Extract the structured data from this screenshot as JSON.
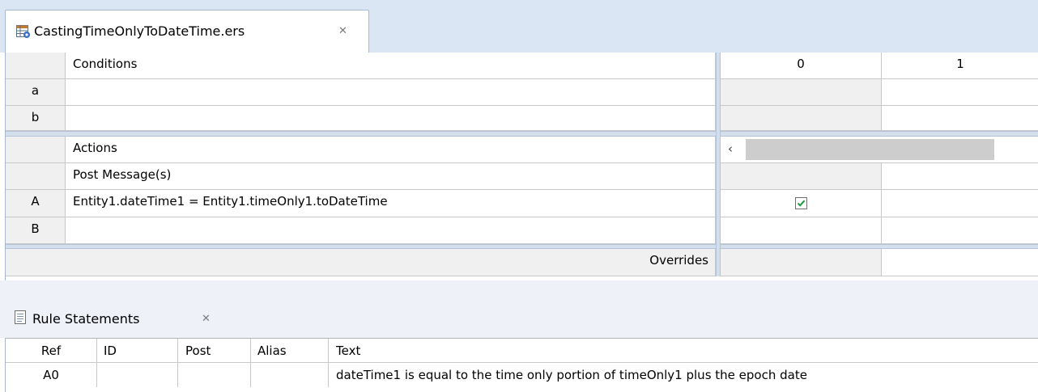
{
  "editor": {
    "tab_title": "CastingTimeOnlyToDateTime.ers",
    "tab_icon": "decision-table-icon",
    "close_icon": "close-icon",
    "conditions_header": "Conditions",
    "column_headers": [
      "0",
      "1"
    ],
    "condition_rows": [
      {
        "label": "a",
        "text": ""
      },
      {
        "label": "b",
        "text": ""
      }
    ],
    "actions_header": "Actions",
    "post_messages_label": "Post Message(s)",
    "action_rows": [
      {
        "label": "A",
        "text": "Entity1.dateTime1 = Entity1.timeOnly1.toDateTime",
        "col0_checked": true
      },
      {
        "label": "B",
        "text": "",
        "col0_checked": false
      }
    ],
    "overrides_label": "Overrides",
    "scroll_left_arrow": "‹"
  },
  "rule_statements": {
    "tab_title": "Rule Statements",
    "tab_icon": "document-icon",
    "close_icon": "close-icon",
    "columns": [
      "Ref",
      "ID",
      "Post",
      "Alias",
      "Text"
    ],
    "rows": [
      {
        "ref": "A0",
        "id": "",
        "post": "",
        "alias": "",
        "text": "dateTime1 is equal to the time only portion of timeOnly1 plus the epoch date"
      }
    ]
  },
  "colors": {
    "tab_bar": "#dbe6f4",
    "separator": "#d4dfee",
    "grey_cell": "#f0f0f0",
    "check_green": "#1e9a3c"
  }
}
